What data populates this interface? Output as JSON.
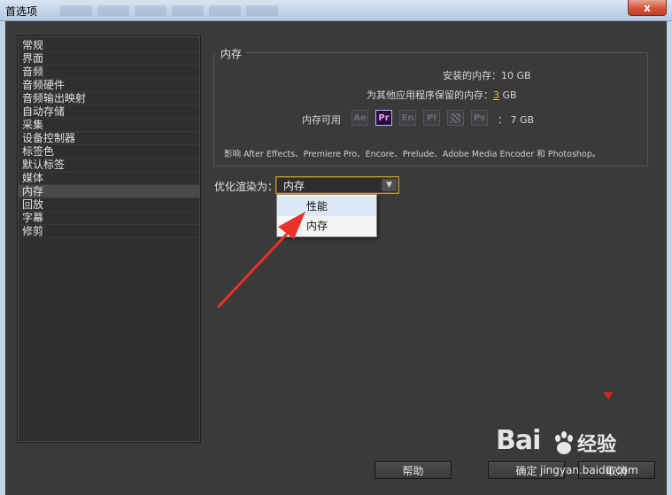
{
  "window": {
    "title": "首选项",
    "close_glyph": "x"
  },
  "sidebar": {
    "items": [
      {
        "label": "常规"
      },
      {
        "label": "界面"
      },
      {
        "label": "音频"
      },
      {
        "label": "音频硬件"
      },
      {
        "label": "音频输出映射"
      },
      {
        "label": "自动存储"
      },
      {
        "label": "采集"
      },
      {
        "label": "设备控制器"
      },
      {
        "label": "标签色"
      },
      {
        "label": "默认标签"
      },
      {
        "label": "媒体"
      },
      {
        "label": "内存"
      },
      {
        "label": "回放"
      },
      {
        "label": "字幕"
      },
      {
        "label": "修剪"
      }
    ],
    "selected": "内存"
  },
  "memory": {
    "group_title": "内存",
    "installed_label": "安装的内存：",
    "installed_value": "10 GB",
    "reserved_label": "为其他应用程序保留的内存：",
    "reserved_value": "3",
    "reserved_unit": "GB",
    "available_label": "内存可用",
    "available_value": "：  7 GB",
    "app_icons": [
      {
        "name": "after-effects-icon",
        "glyph": "Ae",
        "active": false
      },
      {
        "name": "premiere-pro-icon",
        "glyph": "Pr",
        "active": true
      },
      {
        "name": "encore-icon",
        "glyph": "En",
        "active": false
      },
      {
        "name": "prelude-icon",
        "glyph": "Pl",
        "active": false
      },
      {
        "name": "media-encoder-icon",
        "glyph": "",
        "active": false
      },
      {
        "name": "photoshop-icon",
        "glyph": "Ps",
        "active": false
      }
    ],
    "affects_note": "影响 After Effects、Premiere Pro、Encore、Prelude、Adobe Media Encoder 和 Photoshop。"
  },
  "optimize": {
    "label": "优化渲染为：",
    "selected_value": "内存",
    "options": [
      "性能",
      "内存"
    ]
  },
  "buttons": {
    "help": "帮助",
    "ok": "确定",
    "cancel": "取消"
  },
  "watermark": {
    "brand": "Bai",
    "brand2": "经验",
    "url": "jingyan.baidu.com"
  },
  "colors": {
    "accent_border": "#c49a2c",
    "highlight_number": "#e6b84a",
    "annotation_arrow": "#e8322b",
    "premiere_active": "#e6a0ff"
  }
}
